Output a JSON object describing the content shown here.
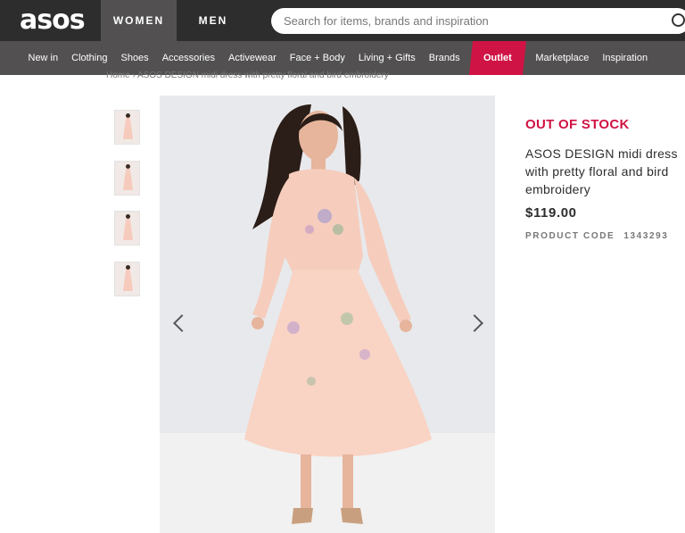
{
  "header": {
    "logo": "asos",
    "gender_tabs": [
      "WOMEN",
      "MEN"
    ],
    "active_tab": "WOMEN",
    "search_placeholder": "Search for items, brands and inspiration"
  },
  "nav": {
    "items": [
      "New in",
      "Clothing",
      "Shoes",
      "Accessories",
      "Activewear",
      "Face + Body",
      "Living + Gifts",
      "Brands",
      "Outlet",
      "Marketplace",
      "Inspiration"
    ],
    "highlight_item": "Outlet",
    "highlight_color": "#d01345"
  },
  "breadcrumb": {
    "text": "Home  ›  ASOS DESIGN midi dress with pretty floral and bird embroidery"
  },
  "product": {
    "status": "OUT OF STOCK",
    "name": "ASOS DESIGN midi dress with pretty floral and bird embroidery",
    "price": "$119.00",
    "code_label": "PRODUCT CODE",
    "code": "1343293"
  },
  "gallery": {
    "thumbnail_count": 4,
    "prev_icon": "chevron-left-icon",
    "next_icon": "chevron-right-icon"
  },
  "colors": {
    "topbar": "#2d2d2d",
    "navbar": "#525050",
    "accent": "#d01345"
  }
}
